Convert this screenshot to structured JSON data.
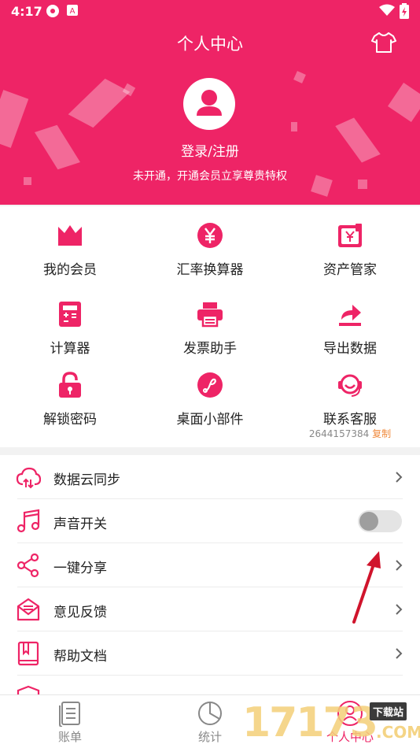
{
  "status_bar": {
    "time": "4:17"
  },
  "header": {
    "title": "个人中心",
    "login_text": "登录/注册",
    "member_tip": "未开通，开通会员立享尊贵特权"
  },
  "grid": {
    "items": [
      {
        "label": "我的会员",
        "icon": "crown-icon"
      },
      {
        "label": "汇率换算器",
        "icon": "yen-coin-icon"
      },
      {
        "label": "资产管家",
        "icon": "wallet-icon"
      },
      {
        "label": "计算器",
        "icon": "calculator-icon"
      },
      {
        "label": "发票助手",
        "icon": "printer-icon"
      },
      {
        "label": "导出数据",
        "icon": "export-icon"
      },
      {
        "label": "解锁密码",
        "icon": "lock-icon"
      },
      {
        "label": "桌面小部件",
        "icon": "widget-icon"
      },
      {
        "label": "联系客服",
        "icon": "customer-service-icon"
      }
    ],
    "contact_number": "2644157384",
    "copy_label": "复制"
  },
  "settings": {
    "items": [
      {
        "label": "数据云同步",
        "icon": "cloud-sync-icon"
      },
      {
        "label": "声音开关",
        "icon": "music-note-icon",
        "toggle_on": false
      },
      {
        "label": "一键分享",
        "icon": "share-icon"
      },
      {
        "label": "意见反馈",
        "icon": "feedback-mail-icon"
      },
      {
        "label": "帮助文档",
        "icon": "help-book-icon"
      }
    ]
  },
  "tabbar": {
    "tabs": [
      {
        "label": "账单",
        "icon": "bill-icon"
      },
      {
        "label": "统计",
        "icon": "pie-chart-icon"
      },
      {
        "label": "个人中心",
        "icon": "user-icon",
        "active": true
      }
    ]
  },
  "watermark": {
    "number": "17173",
    "tag": "下载站",
    "domain": ".COM"
  },
  "colors": {
    "accent": "#ee2466",
    "copy": "#f08a3c",
    "annotation_arrow": "#d0142c"
  }
}
